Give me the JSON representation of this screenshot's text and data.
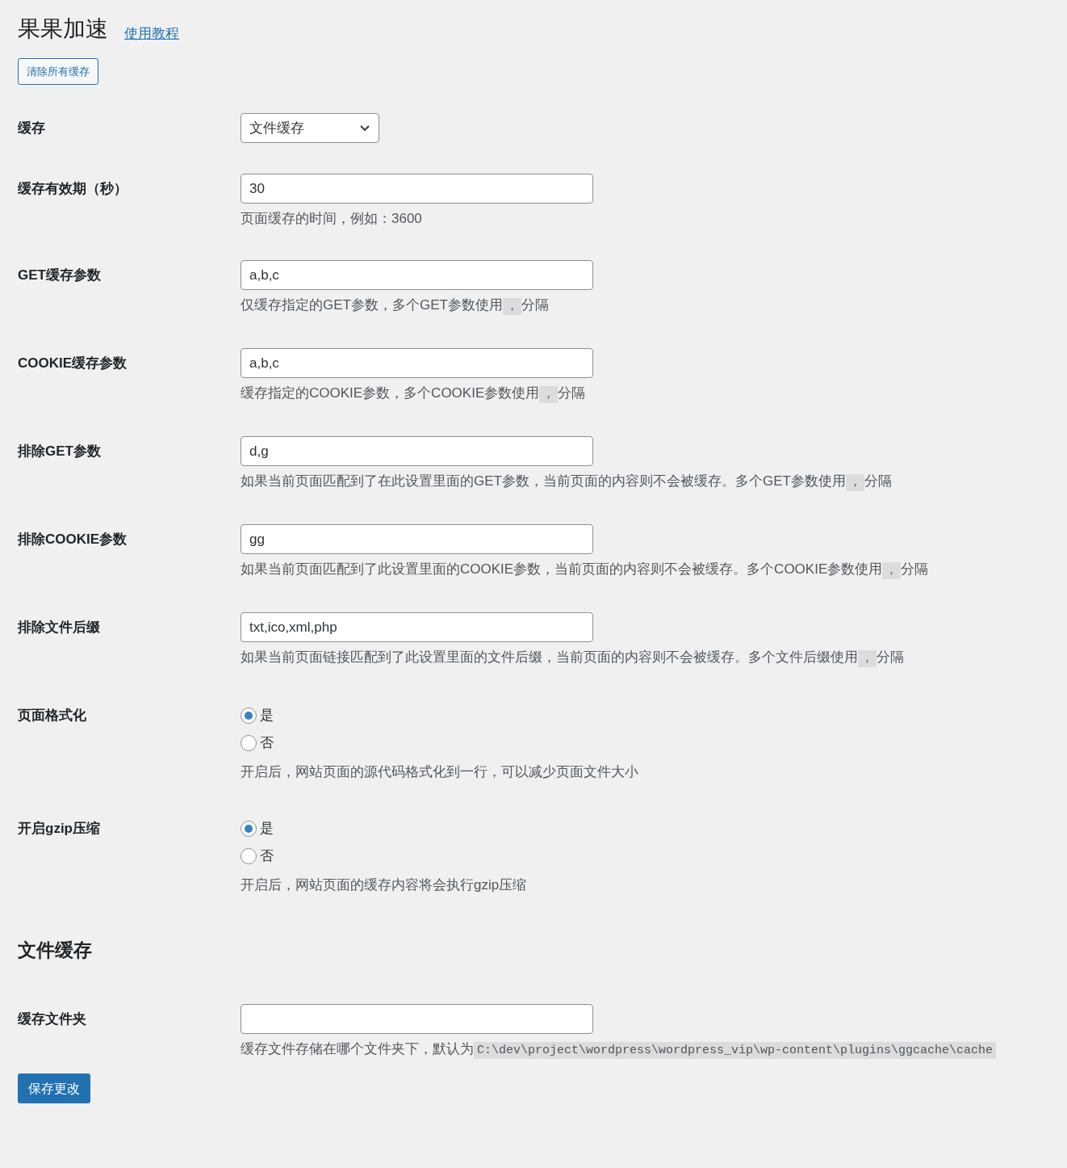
{
  "title": "果果加速",
  "tutorial_link": "使用教程",
  "clear_button": "清除所有缓存",
  "rows": [
    {
      "kind": "select",
      "label": "缓存",
      "value": "文件缓存"
    },
    {
      "kind": "text",
      "label": "缓存有效期（秒）",
      "value": "30",
      "description": "页面缓存的时间，例如：3600"
    },
    {
      "kind": "text",
      "label": "GET缓存参数",
      "value": "a,b,c",
      "description": "仅缓存指定的GET参数，多个GET参数使用",
      "code": "，",
      "description_end": "分隔"
    },
    {
      "kind": "text",
      "label": "COOKIE缓存参数",
      "value": "a,b,c",
      "description": "缓存指定的COOKIE参数，多个COOKIE参数使用",
      "code": "，",
      "description_end": "分隔"
    },
    {
      "kind": "text",
      "label": "排除GET参数",
      "value": "d,g",
      "description": "如果当前页面匹配到了在此设置里面的GET参数，当前页面的内容则不会被缓存。多个GET参数使用",
      "code": "，",
      "description_end": "分隔"
    },
    {
      "kind": "text",
      "label": "排除COOKIE参数",
      "value": "gg",
      "description": "如果当前页面匹配到了此设置里面的COOKIE参数，当前页面的内容则不会被缓存。多个COOKIE参数使用",
      "code": "，",
      "description_end": "分隔"
    },
    {
      "kind": "text",
      "label": "排除文件后缀",
      "value": "txt,ico,xml,php",
      "description": "如果当前页面链接匹配到了此设置里面的文件后缀，当前页面的内容则不会被缓存。多个文件后缀使用",
      "code": "，",
      "description_end": "分隔"
    },
    {
      "kind": "radio",
      "label": "页面格式化",
      "options": [
        {
          "label": "是",
          "selected": true
        },
        {
          "label": "否",
          "selected": false
        }
      ],
      "description": "开启后，网站页面的源代码格式化到一行，可以减少页面文件大小"
    },
    {
      "kind": "radio",
      "label": "开启gzip压缩",
      "options": [
        {
          "label": "是",
          "selected": true
        },
        {
          "label": "否",
          "selected": false
        }
      ],
      "description": "开启后，网站页面的缓存内容将会执行gzip压缩"
    }
  ],
  "section_title": "文件缓存",
  "section_rows": [
    {
      "kind": "text",
      "label": "缓存文件夹",
      "value": "",
      "description": "缓存文件存储在哪个文件夹下，默认为",
      "code": "C:\\dev\\project\\wordpress\\wordpress_vip\\wp-content\\plugins\\ggcache\\cache"
    }
  ],
  "save_button": "保存更改"
}
